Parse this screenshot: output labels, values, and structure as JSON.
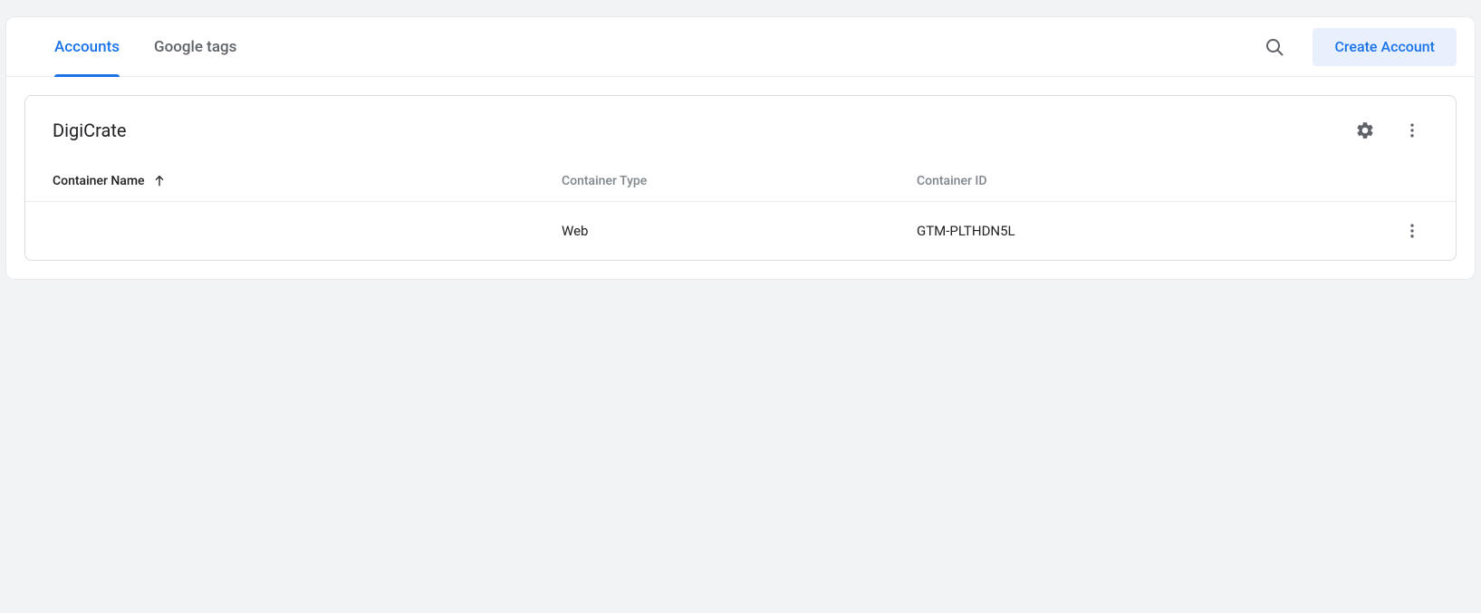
{
  "tabs": {
    "accounts": "Accounts",
    "google_tags": "Google tags"
  },
  "actions": {
    "create_account": "Create Account"
  },
  "account": {
    "title": "DigiCrate",
    "columns": {
      "name": "Container Name",
      "type": "Container Type",
      "id": "Container ID"
    },
    "rows": [
      {
        "name": "",
        "type": "Web",
        "id": "GTM-PLTHDN5L"
      }
    ]
  }
}
